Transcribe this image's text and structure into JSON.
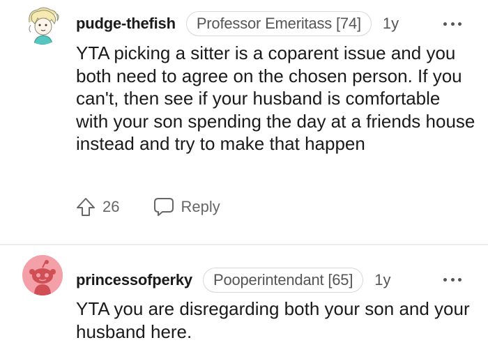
{
  "comments": [
    {
      "username": "pudge-thefish",
      "flair": "Professor Emeritass [74]",
      "age": "1y",
      "body": "YTA picking a sitter is a coparent issue and you both need to agree on the chosen person. If you can't, then see if your husband is comfortable with your son spending the day at a friends house instead and try to make that happen",
      "score": "26",
      "reply_label": "Reply",
      "avatar_icon": "cartoon-avatar-icon"
    },
    {
      "username": "princessofperky",
      "flair": "Pooperintendant [65]",
      "age": "1y",
      "body": "YTA you are disregarding both your son and your husband here.",
      "avatar_icon": "default-snoo-avatar-icon"
    }
  ],
  "colors": {
    "text": "#1a1a1b",
    "meta": "#555555",
    "flair_border": "#d7d7d7",
    "divider": "#ededed",
    "snoo_background": "#f4a0a8"
  }
}
